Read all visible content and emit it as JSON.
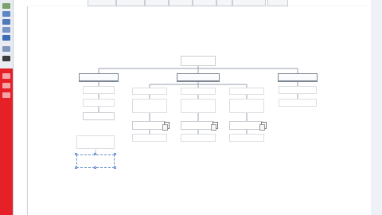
{
  "toolbar": {
    "tabs": [
      "",
      "",
      "",
      "",
      "",
      "",
      "",
      ""
    ]
  },
  "chart": {
    "root": "",
    "level1": [
      "",
      "",
      ""
    ],
    "left_branch": [
      "",
      "",
      ""
    ],
    "middle_branch": {
      "columns": [
        [
          "",
          "",
          "",
          ""
        ],
        [
          "",
          "",
          "",
          ""
        ],
        [
          "",
          "",
          "",
          ""
        ]
      ]
    },
    "right_branch": [
      "",
      ""
    ],
    "loose_boxes": [
      "",
      ""
    ]
  },
  "colors": {
    "accent_red": "#e52127",
    "selection_blue": "#6b8fcf"
  }
}
